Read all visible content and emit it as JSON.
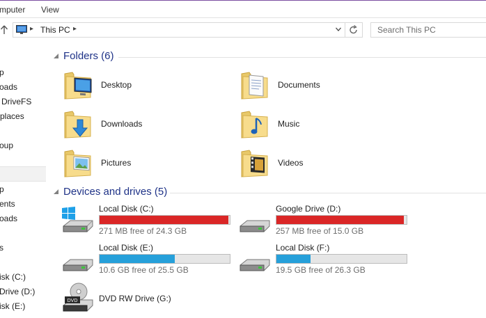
{
  "colors": {
    "accent": "#7a4ea0",
    "group_title": "#1e3287",
    "bar_full": "#da2626",
    "bar_normal": "#26a0da"
  },
  "ribbon": {
    "tab_computer": "mputer",
    "tab_view": "View"
  },
  "address": {
    "crumb": "This PC",
    "icon": "computer-icon"
  },
  "search": {
    "placeholder": "Search This PC"
  },
  "nav": {
    "items": [
      "p",
      "oads",
      "DriveFS",
      "places",
      "oup",
      "p",
      "ents",
      "oads",
      "s",
      "isk (C:)",
      "Drive (D:)",
      "isk (E:)"
    ]
  },
  "folders": {
    "title": "Folders (6)",
    "items": [
      {
        "label": "Desktop",
        "icon": "desktop-folder-icon"
      },
      {
        "label": "Documents",
        "icon": "documents-folder-icon"
      },
      {
        "label": "Downloads",
        "icon": "downloads-folder-icon"
      },
      {
        "label": "Music",
        "icon": "music-folder-icon"
      },
      {
        "label": "Pictures",
        "icon": "pictures-folder-icon"
      },
      {
        "label": "Videos",
        "icon": "videos-folder-icon"
      }
    ]
  },
  "devices": {
    "title": "Devices and drives (5)",
    "items": [
      {
        "name": "Local Disk (C:)",
        "free": "271 MB free of 24.3 GB",
        "used_fraction": 0.99,
        "status": "full",
        "icon": "windows-drive-icon"
      },
      {
        "name": "Google Drive (D:)",
        "free": "257 MB free of 15.0 GB",
        "used_fraction": 0.98,
        "status": "full",
        "icon": "hard-drive-icon"
      },
      {
        "name": "Local Disk (E:)",
        "free": "10.6 GB free of 25.5 GB",
        "used_fraction": 0.58,
        "status": "normal",
        "icon": "hard-drive-icon"
      },
      {
        "name": "Local Disk (F:)",
        "free": "19.5 GB free of 26.3 GB",
        "used_fraction": 0.26,
        "status": "normal",
        "icon": "hard-drive-icon"
      },
      {
        "name": "DVD RW Drive (G:)",
        "icon": "dvd-drive-icon",
        "badge": "DVD"
      }
    ]
  }
}
